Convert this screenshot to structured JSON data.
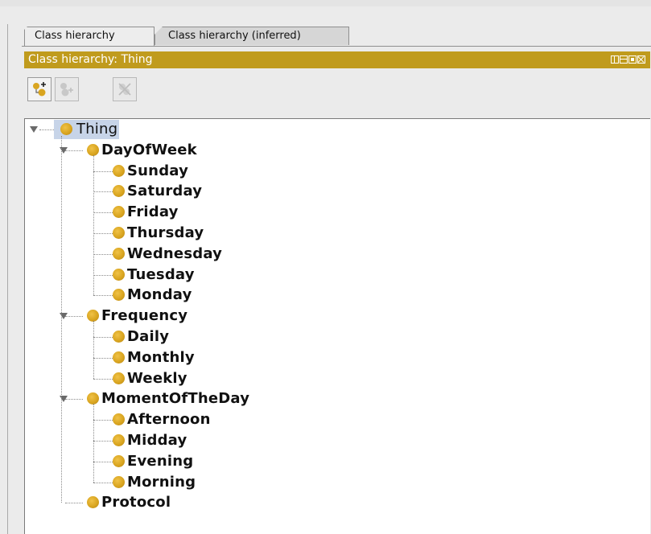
{
  "tabs": [
    {
      "label": "Class hierarchy",
      "active": true
    },
    {
      "label": "Class hierarchy (inferred)",
      "active": false
    }
  ],
  "view": {
    "title": "Class hierarchy: Thing",
    "controls": [
      "split-vertical-icon",
      "split-horizontal-icon",
      "maximize-icon",
      "close-view-icon"
    ]
  },
  "toolbar": {
    "buttons": [
      {
        "icon": "add-subclass-icon",
        "enabled": true
      },
      {
        "icon": "add-sibling-class-icon",
        "enabled": false
      },
      {
        "icon": "delete-class-icon",
        "enabled": false
      }
    ]
  },
  "colors": {
    "header": "#c09b1d",
    "class_dot": "#d9a520",
    "selection": "#c7d4e8"
  },
  "tree": {
    "root": "Thing",
    "children": [
      {
        "label": "DayOfWeek",
        "children": [
          "Sunday",
          "Saturday",
          "Friday",
          "Thursday",
          "Wednesday",
          "Tuesday",
          "Monday"
        ]
      },
      {
        "label": "Frequency",
        "children": [
          "Daily",
          "Monthly",
          "Weekly"
        ]
      },
      {
        "label": "MomentOfTheDay",
        "children": [
          "Afternoon",
          "Midday",
          "Evening",
          "Morning"
        ]
      },
      {
        "label": "Protocol",
        "children": []
      }
    ]
  }
}
